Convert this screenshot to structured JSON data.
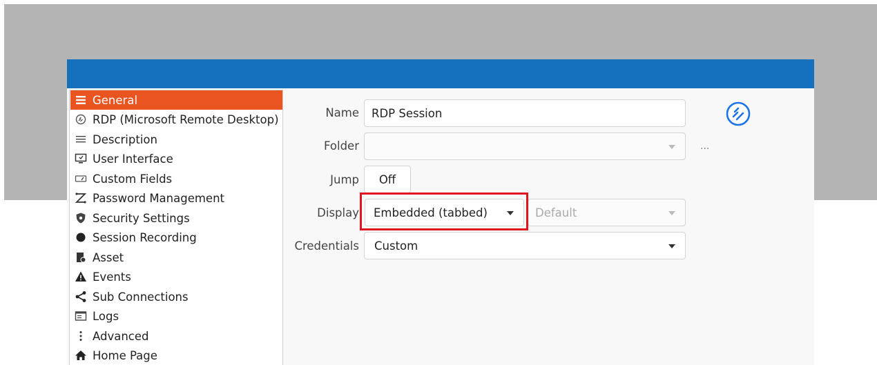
{
  "sidebar": {
    "items": [
      {
        "label": "General",
        "icon": "hamburger-icon"
      },
      {
        "label": "RDP (Microsoft Remote Desktop)",
        "icon": "rdp-icon"
      },
      {
        "label": "Description",
        "icon": "lines-icon"
      },
      {
        "label": "User Interface",
        "icon": "monitor-icon"
      },
      {
        "label": "Custom Fields",
        "icon": "tag-icon"
      },
      {
        "label": "Password Management",
        "icon": "password-icon"
      },
      {
        "label": "Security Settings",
        "icon": "shield-icon"
      },
      {
        "label": "Session Recording",
        "icon": "record-icon"
      },
      {
        "label": "Asset",
        "icon": "asset-icon"
      },
      {
        "label": "Events",
        "icon": "warning-icon"
      },
      {
        "label": "Sub Connections",
        "icon": "share-icon"
      },
      {
        "label": "Logs",
        "icon": "logs-icon"
      },
      {
        "label": "Advanced",
        "icon": "dots-icon"
      },
      {
        "label": "Home Page",
        "icon": "home-icon"
      }
    ],
    "active_index": 0
  },
  "form": {
    "name_label": "Name",
    "name_value": "RDP Session",
    "folder_label": "Folder",
    "folder_value": "",
    "folder_more": "...",
    "jump_label": "Jump",
    "jump_value": "Off",
    "display_label": "Display",
    "display_value": "Embedded (tabbed)",
    "display_secondary": "Default",
    "credentials_label": "Credentials",
    "credentials_value": "Custom"
  },
  "colors": {
    "titlebar": "#1570be",
    "active_item": "#e95420",
    "highlight": "#e0141e",
    "rdp_logo": "#1a73e8"
  }
}
